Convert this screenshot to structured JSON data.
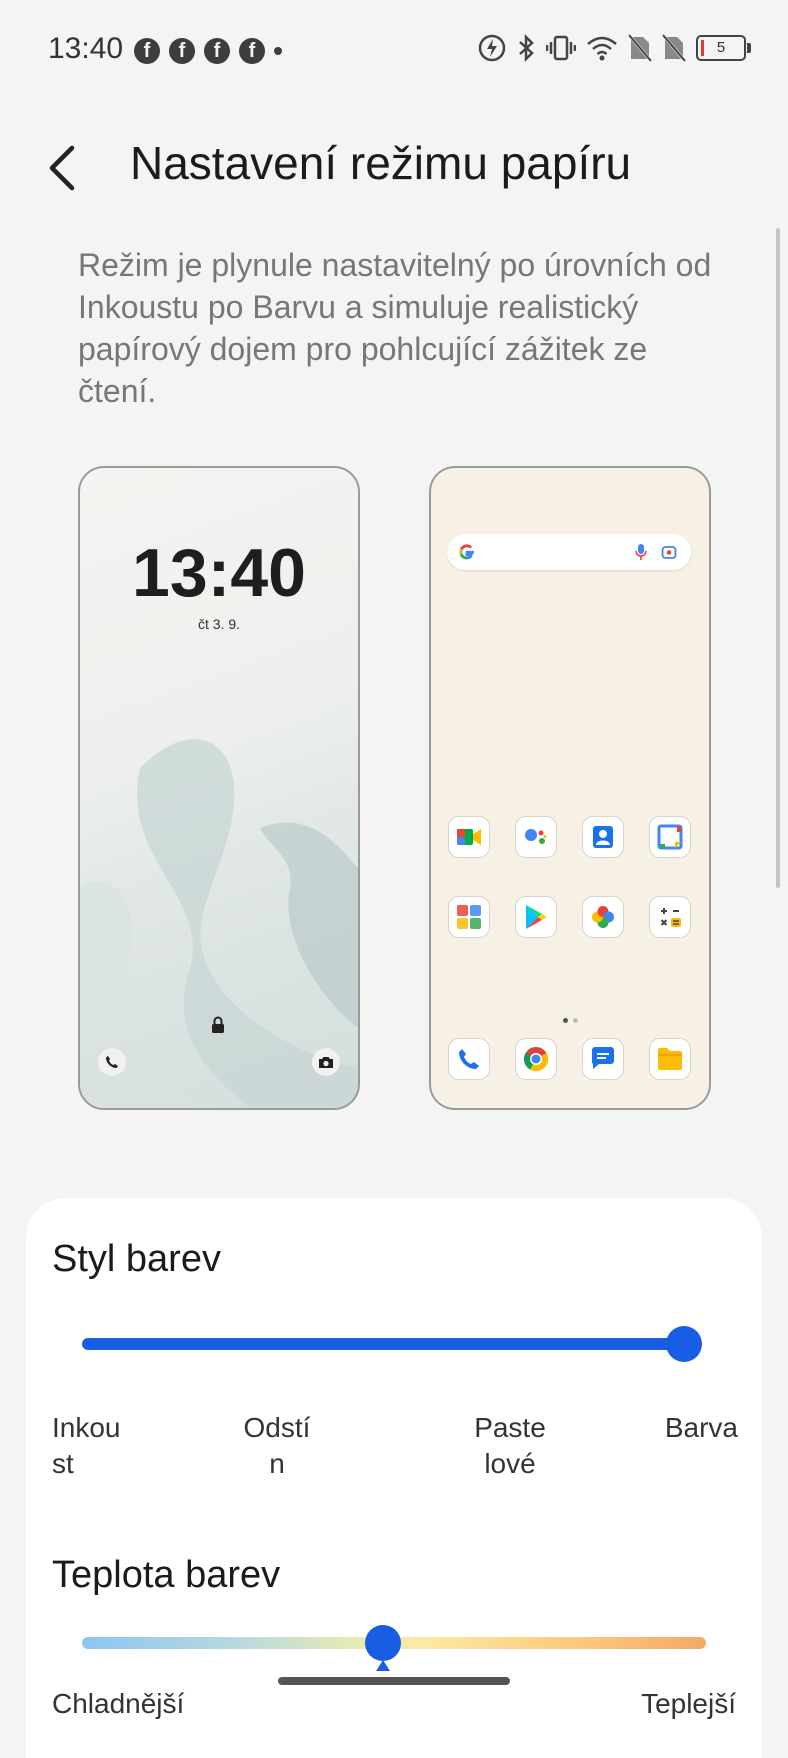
{
  "status_bar": {
    "time": "13:40",
    "notification_icons": [
      "facebook-icon",
      "facebook-icon",
      "facebook-icon",
      "facebook-icon"
    ],
    "battery_level": "5"
  },
  "header": {
    "title": "Nastavení režimu papíru"
  },
  "description": "Režim je plynule nastavitelný po úrovních od Inkoustu po Barvu a simuluje realistický papírový dojem pro pohlcující zážitek ze čtení.",
  "preview": {
    "lock_time": "13:40",
    "lock_date": "čt 3. 9."
  },
  "color_style": {
    "title": "Styl barev",
    "value": 1.0,
    "levels": [
      "Inkou\nst",
      "Odstí\nn",
      "Paste\nlové",
      "Barva"
    ]
  },
  "color_temperature": {
    "title": "Teplota barev",
    "value": 0.48,
    "left_label": "Chladnější",
    "right_label": "Teplejší"
  },
  "colors": {
    "accent": "#1a5de5",
    "background": "#f4f4f4"
  }
}
